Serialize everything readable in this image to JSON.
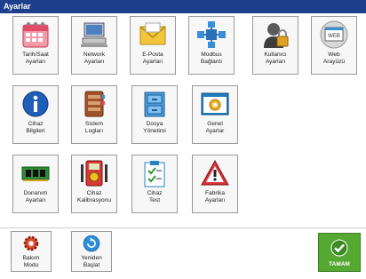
{
  "window": {
    "title": "Ayarlar"
  },
  "tiles": [
    {
      "label": "Tarih/Saat\nAyarları"
    },
    {
      "label": "Network\nAyarları"
    },
    {
      "label": "E-Posta\nAyarları"
    },
    {
      "label": "Modbus\nBağlantı"
    },
    {
      "label": "Kullanıcı\nAyarları"
    },
    {
      "label": "Web\nArayüzü"
    },
    {
      "label": "Cihaz\nBilgileri"
    },
    {
      "label": "Sistem\nLogları"
    },
    {
      "label": "Dosya\nYönetimi"
    },
    {
      "label": "Genel\nAyarlar"
    },
    {
      "label": "Donanım\nAyarları"
    },
    {
      "label": "Cihaz\nKalibrasyonu"
    },
    {
      "label": "Cihaz\nTest"
    },
    {
      "label": "Fabrika\nAyarları"
    },
    {
      "label": "Bakım\nModu"
    },
    {
      "label": "Yeniden\nBaşlat"
    }
  ],
  "ok_button": {
    "label": "TAMAM"
  },
  "colors": {
    "titlebar": "#1e3f8c",
    "ok": "#55a832"
  }
}
